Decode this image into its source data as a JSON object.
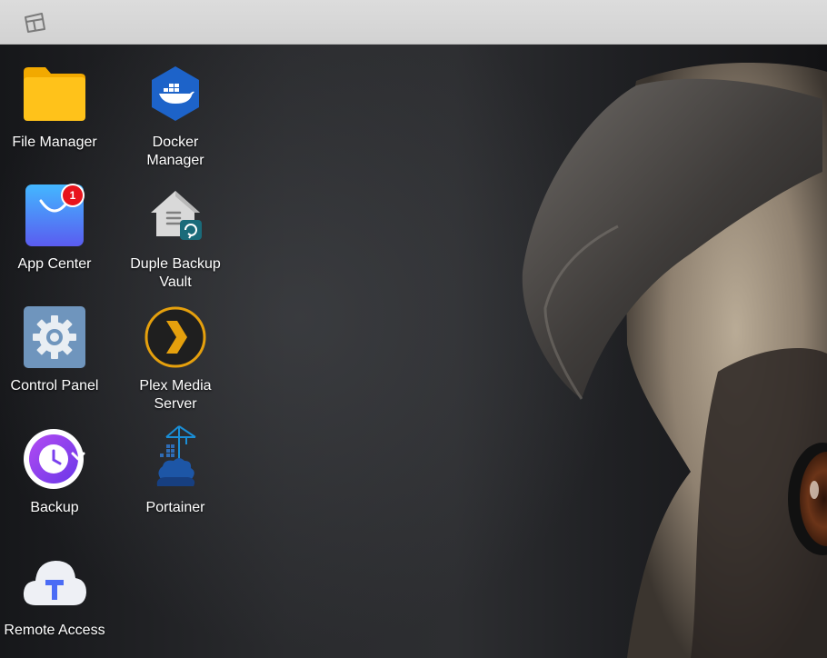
{
  "topbar": {
    "desktop_icon": "show-desktop-icon"
  },
  "apps": [
    {
      "label": "File Manager",
      "icon": "folder-icon"
    },
    {
      "label": "Docker\nManager",
      "icon": "docker-icon"
    },
    {
      "label": "App Center",
      "icon": "shopping-bag-icon",
      "badge": "1"
    },
    {
      "label": "Duple Backup\nVault",
      "icon": "backup-vault-icon"
    },
    {
      "label": "Control Panel",
      "icon": "gear-icon"
    },
    {
      "label": "Plex Media\nServer",
      "icon": "plex-icon"
    },
    {
      "label": "Backup",
      "icon": "backup-clock-icon"
    },
    {
      "label": "Portainer",
      "icon": "portainer-icon"
    },
    {
      "label": "Remote Access",
      "icon": "cloud-t-icon"
    }
  ],
  "colors": {
    "topbar": "#d6d6d6",
    "folder": "#ffc21a",
    "docker": "#1d63c9",
    "app_center": "#3e7cf5",
    "badge": "#e8141d",
    "plex": "#e5a00d",
    "backup": "#8b3ff0",
    "remote_access": "#4b6cf5"
  }
}
